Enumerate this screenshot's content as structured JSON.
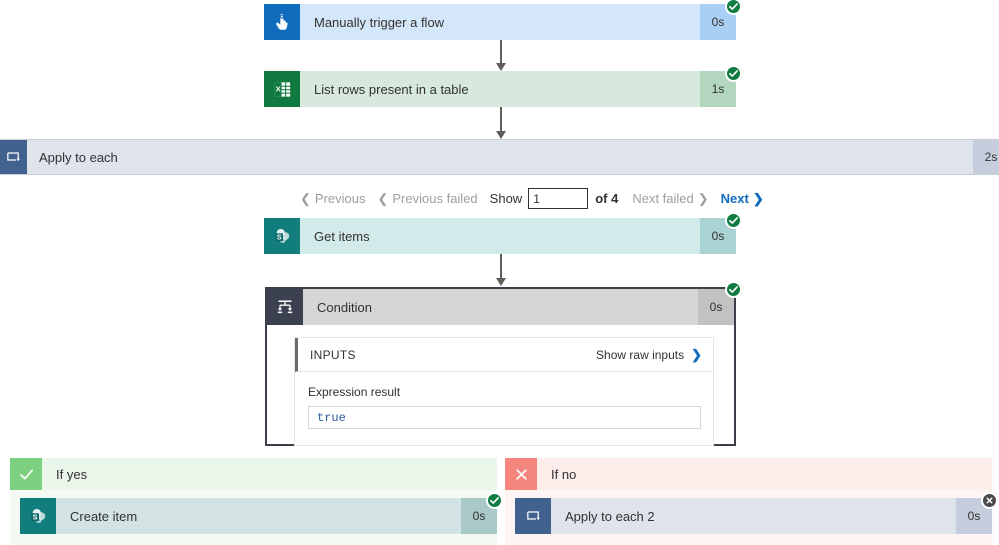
{
  "flow": {
    "steps": [
      {
        "name": "manually-trigger-a-flow",
        "label": "Manually trigger a flow",
        "duration": "0s",
        "icon": "tap-hand-icon",
        "status": "succeeded",
        "tile_color": "#0f6cbd",
        "body_color": "#d4e7fa",
        "dur_color": "#a9cff5"
      },
      {
        "name": "list-rows-present-in-a-table",
        "label": "List rows present in a table",
        "duration": "1s",
        "icon": "excel-icon",
        "status": "succeeded",
        "tile_color": "#10793f",
        "body_color": "#d7e9dc",
        "dur_color": "#b3d6bf"
      }
    ],
    "scope": {
      "name": "apply-to-each",
      "label": "Apply to each",
      "duration": "2s",
      "icon": "loop-icon"
    },
    "pager": {
      "previous": "Previous",
      "previous_failed": "Previous failed",
      "show_label": "Show",
      "page_value": "1",
      "page_placeholder": "1",
      "of_text": "of 4",
      "next_failed": "Next failed",
      "next": "Next"
    },
    "inner_steps": [
      {
        "name": "get-items",
        "label": "Get items",
        "duration": "0s",
        "icon": "sharepoint-icon",
        "status": "succeeded",
        "tile_color": "#127d7d",
        "body_color": "#d3eaea",
        "dur_color": "#a9d2d2"
      }
    ],
    "condition": {
      "name": "condition",
      "label": "Condition",
      "duration": "0s",
      "icon": "condition-icon",
      "status": "succeeded",
      "inputs": {
        "header": "INPUTS",
        "show_raw": "Show raw inputs",
        "field_label": "Expression result",
        "field_value": "true"
      }
    },
    "branches": [
      {
        "name": "if-yes",
        "label": "If yes",
        "mark_icon": "check-icon",
        "action": {
          "name": "create-item",
          "label": "Create item",
          "duration": "0s",
          "icon": "sharepoint-icon",
          "status": "succeeded",
          "tile_color": "#127d7d",
          "body_color": "#d3e3e3",
          "dur_color": "#a9c8c8"
        }
      },
      {
        "name": "if-no",
        "label": "If no",
        "mark_icon": "close-icon",
        "action": {
          "name": "apply-to-each-2",
          "label": "Apply to each 2",
          "duration": "0s",
          "icon": "loop-icon",
          "status": "skipped",
          "tile_color": "#41618f",
          "body_color": "#dfe3ec",
          "dur_color": "#c6cedd"
        }
      }
    ]
  },
  "colors": {
    "success": "#107c41",
    "skipped": "#4a4a4a",
    "accent": "#0f6cbd",
    "disabled": "#a19f9d",
    "code": "#2b579a"
  }
}
